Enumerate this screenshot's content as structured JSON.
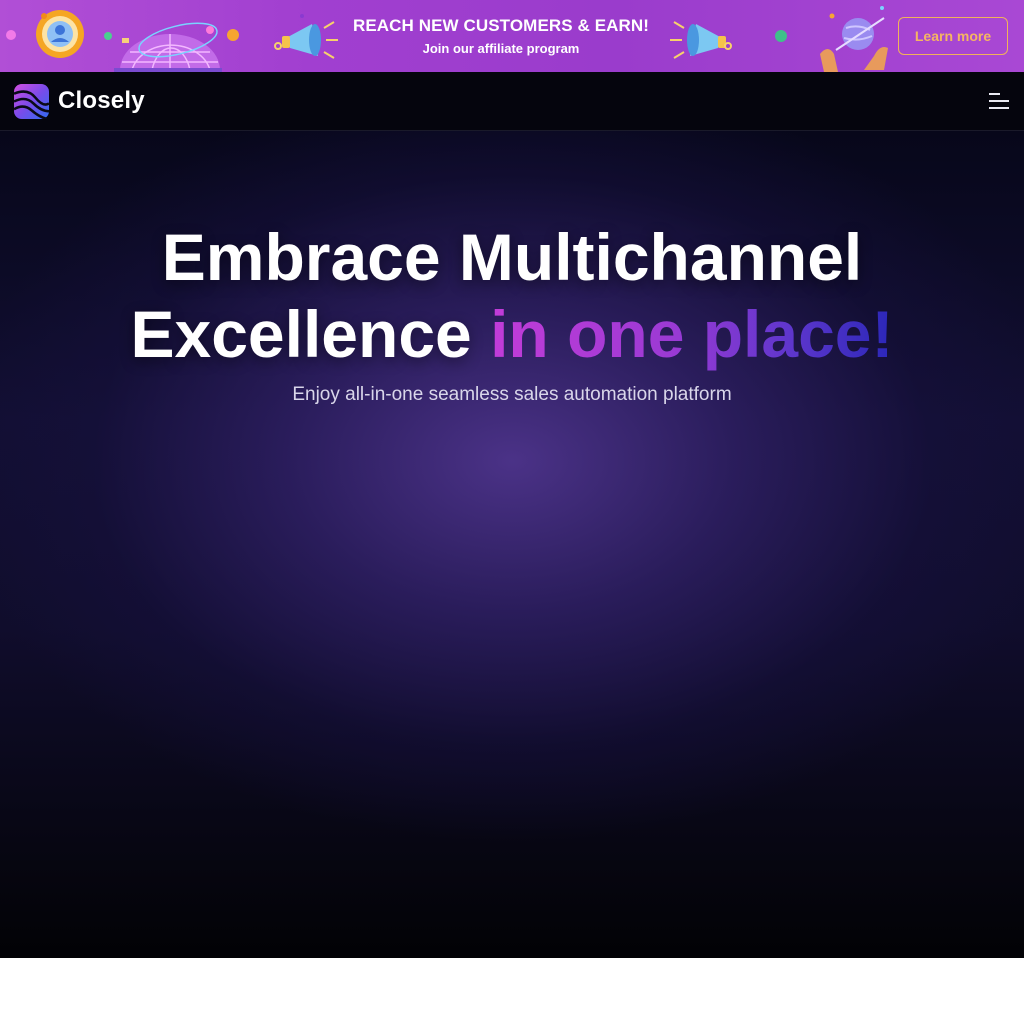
{
  "promo": {
    "title": "REACH NEW CUSTOMERS & EARN!",
    "subtitle": "Join our affiliate program",
    "cta_label": "Learn more",
    "colors": {
      "background": "#a13fd0",
      "cta_border": "#f1b25a"
    },
    "icons": [
      "target-icon",
      "globe-icon",
      "megaphone-icon",
      "megaphone-icon",
      "planet-in-hands-icon"
    ]
  },
  "nav": {
    "brand": "Closely",
    "logo_icon": "closely-logo-icon",
    "menu_icon": "hamburger-menu-icon"
  },
  "hero": {
    "headline_line1": "Embrace Multichannel",
    "headline_line2_plain": "Excellence",
    "headline_line2_accent": "in one place!",
    "tagline": "Enjoy all-in-one seamless sales automation platform",
    "colors": {
      "accent_start": "#c23cd8",
      "accent_end": "#2a27b8"
    }
  }
}
